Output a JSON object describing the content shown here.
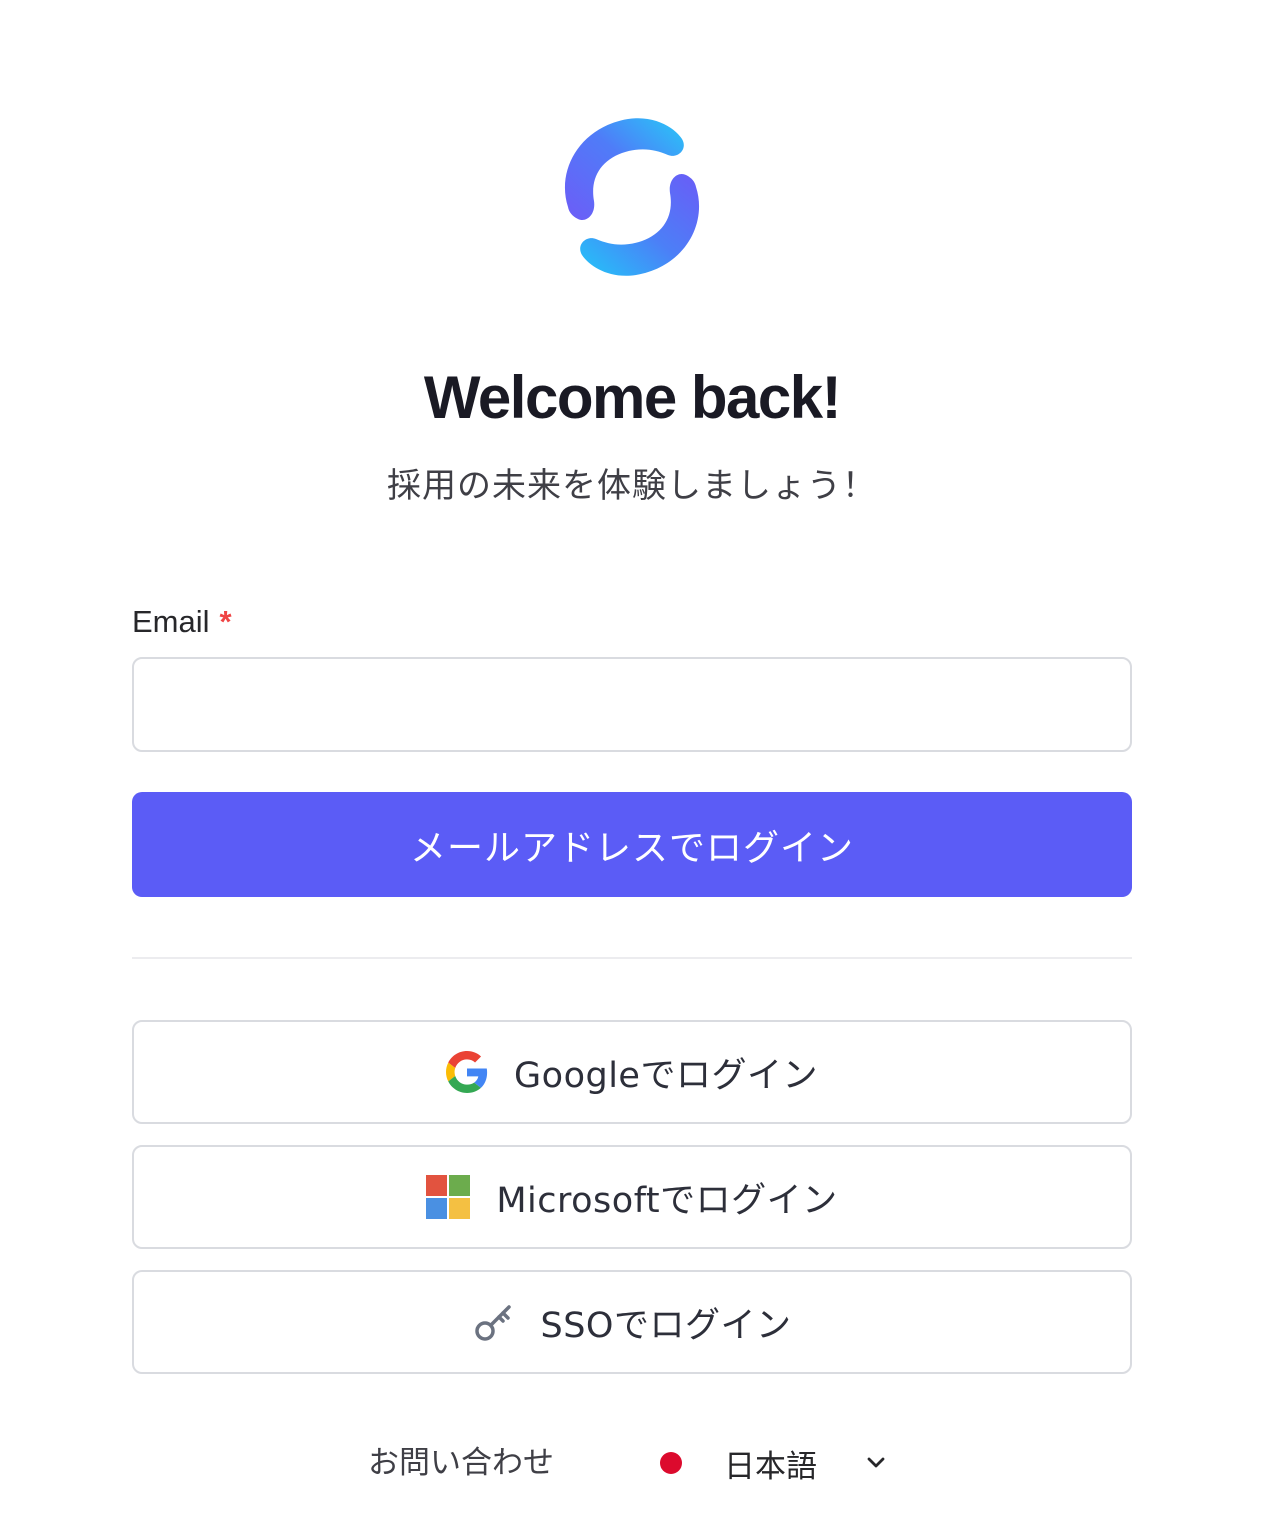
{
  "header": {
    "title": "Welcome back!",
    "subtitle": "採用の未来を体験しましょう！"
  },
  "form": {
    "email_label": "Email",
    "required_marker": "*",
    "email_value": "",
    "email_placeholder": "",
    "email_submit_label": "メールアドレスでログイン"
  },
  "oauth": {
    "google_label": "Googleでログイン",
    "microsoft_label": "Microsoftでログイン",
    "sso_label": "SSOでログイン"
  },
  "footer": {
    "contact_label": "お問い合わせ",
    "language_label": "日本語"
  },
  "colors": {
    "primary": "#5b5cf6",
    "required": "#ef4444",
    "flag_red": "#dc0a2d"
  },
  "icons": {
    "logo": "brand-logo-icon",
    "google": "google-icon",
    "microsoft": "microsoft-icon",
    "sso": "key-icon",
    "language_flag": "japan-flag-icon",
    "dropdown": "chevron-down-icon"
  }
}
